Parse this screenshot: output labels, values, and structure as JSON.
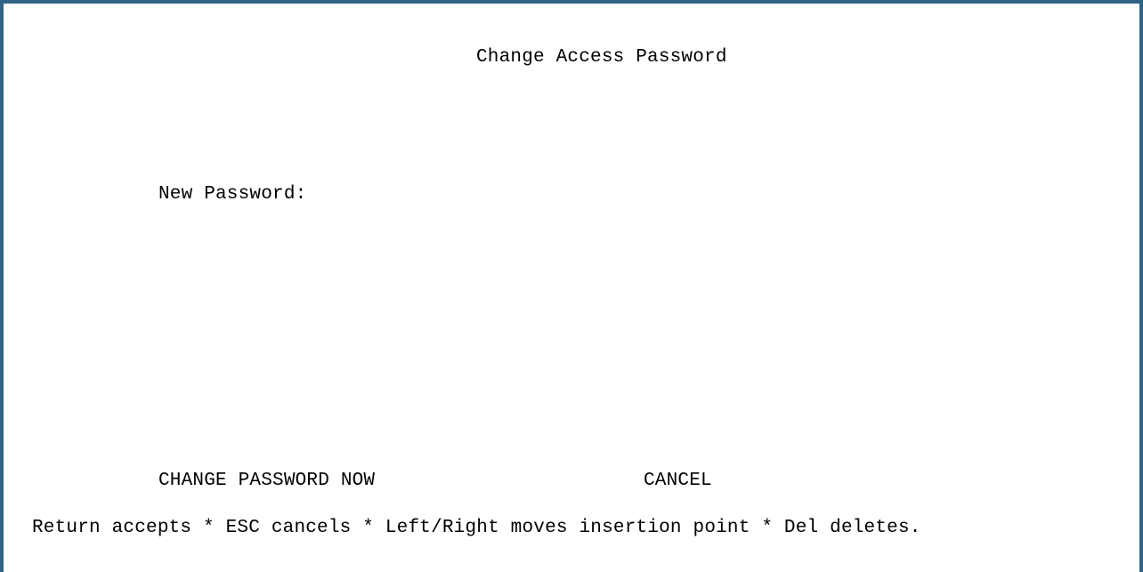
{
  "screen": {
    "title": "Change Access Password",
    "new_password_label": "New Password:",
    "new_password_value": "",
    "frame_color": "#2f6485"
  },
  "actions": {
    "change_label": "CHANGE PASSWORD NOW",
    "cancel_label": "CANCEL"
  },
  "help_line": "Return accepts * ESC cancels * Left/Right moves insertion point * Del deletes."
}
